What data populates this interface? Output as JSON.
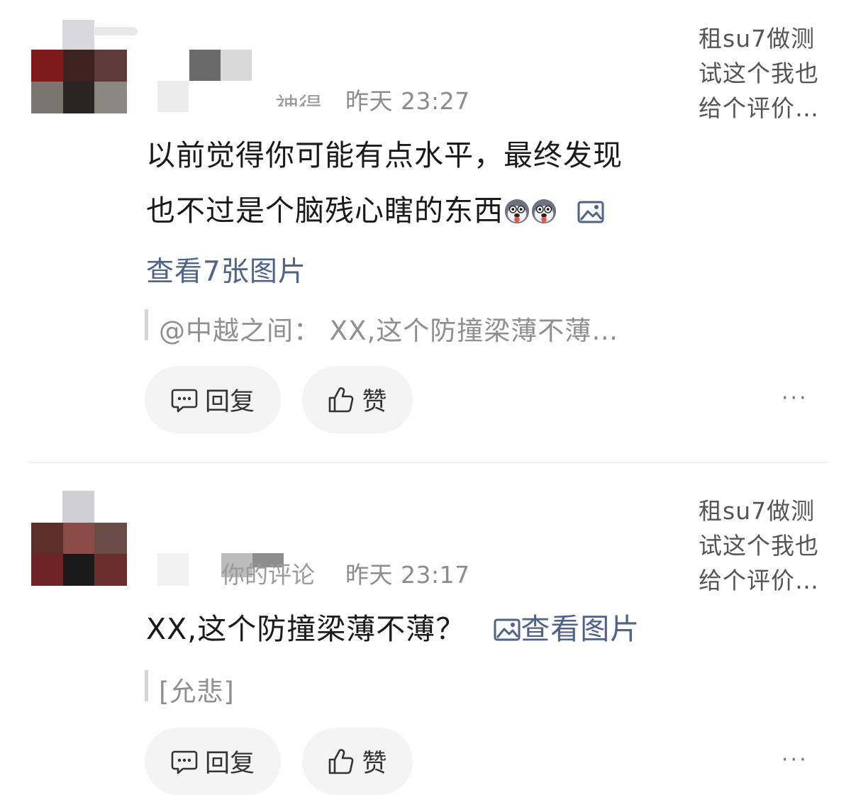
{
  "comments": [
    {
      "author_partial": "神得",
      "time": "昨天 23:27",
      "text_line1": "以前觉得你可能有点水平，最终发现",
      "text_line2": "也不过是个脑残心瞎的东西",
      "emoji_names": [
        "husky-emoji",
        "husky-emoji"
      ],
      "view_images_link": "查看7张图片",
      "quote": "@中越之间：  XX,这个防撞梁薄不薄…",
      "actions": {
        "reply": "回复",
        "like": "赞",
        "more": "···"
      },
      "post_preview": "租su7做测试这个我也给个评价…"
    },
    {
      "author_partial": "你的评论",
      "time": "昨天 23:17",
      "text": "XX,这个防撞梁薄不薄？",
      "view_image_link": "查看图片",
      "quote": "[允悲]",
      "actions": {
        "reply": "回复",
        "like": "赞",
        "more": "···"
      },
      "post_preview": "租su7做测试这个我也给个评价…"
    }
  ],
  "colors": {
    "link": "#4f6287",
    "meta": "#8c8c8c",
    "pill_bg": "#f4f4f4",
    "quote_bar": "#d4d4d4"
  }
}
